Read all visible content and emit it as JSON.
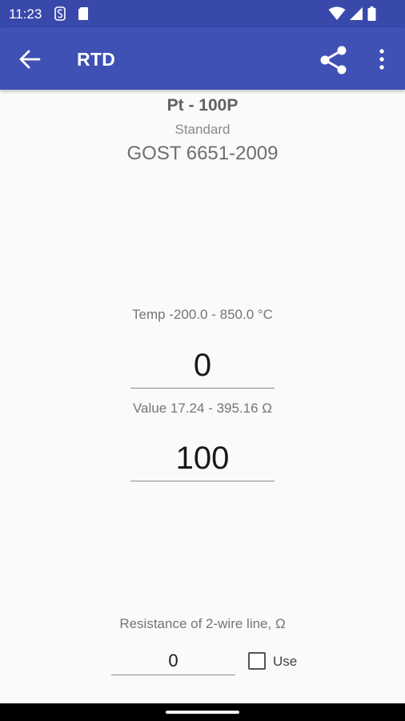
{
  "status_bar": {
    "time": "11:23",
    "icons": [
      "signal-s-icon",
      "sd-card-icon",
      "wifi-icon",
      "cell-signal-icon",
      "battery-icon"
    ]
  },
  "app_bar": {
    "title": "RTD",
    "color": "#3f51b5",
    "icons": [
      "back-arrow-icon",
      "share-icon",
      "more-vert-icon"
    ]
  },
  "sensor": {
    "name": "Pt - 100P",
    "standard_label": "Standard",
    "standard_value": "GOST 6651-2009"
  },
  "temperature": {
    "range_label": "Temp -200.0 - 850.0 °C",
    "value": "0"
  },
  "resistance": {
    "range_label": "Value 17.24 - 395.16  Ω",
    "value": "100"
  },
  "line": {
    "label": "Resistance of 2-wire line, Ω",
    "value": "0",
    "use_label": "Use",
    "use_checked": false
  }
}
